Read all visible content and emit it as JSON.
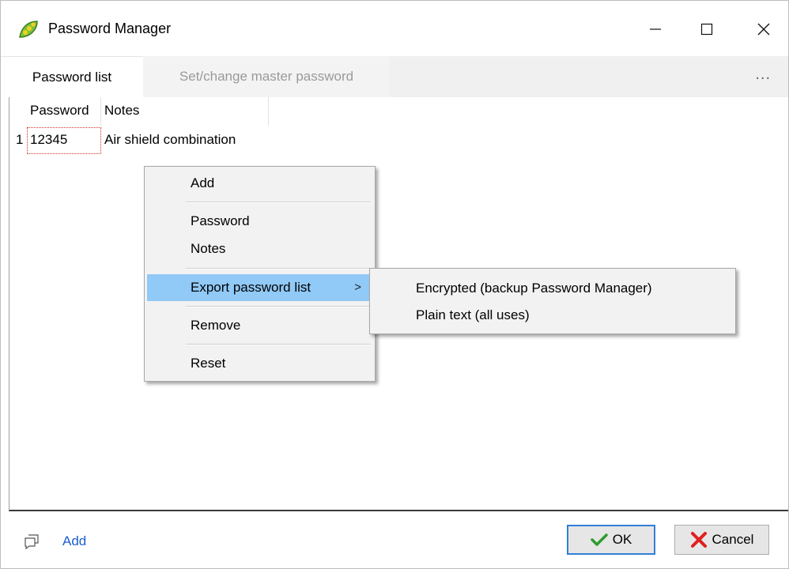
{
  "window": {
    "title": "Password Manager",
    "controls": {
      "minimize": "minimize-icon",
      "maximize": "maximize-icon",
      "close": "close-icon"
    }
  },
  "tabs": [
    {
      "label": "Password list",
      "active": true
    },
    {
      "label": "Set/change master password",
      "active": false
    }
  ],
  "tabs_more": "...",
  "grid": {
    "columns": [
      "Password",
      "Notes"
    ],
    "rows": [
      {
        "index": "1",
        "password": "12345",
        "notes": "Air shield combination"
      }
    ]
  },
  "context_menu": {
    "items": [
      {
        "label": "Add"
      },
      {
        "label": "Password"
      },
      {
        "label": "Notes"
      },
      {
        "label": "Export password list",
        "submenu": true,
        "highlighted": true
      },
      {
        "label": "Remove"
      },
      {
        "label": "Reset"
      }
    ],
    "submenu_arrow": ">"
  },
  "export_submenu": {
    "items": [
      {
        "label": "Encrypted (backup Password Manager)"
      },
      {
        "label": "Plain text (all uses)"
      }
    ]
  },
  "footer": {
    "add_label": "Add",
    "ok_label": "OK",
    "cancel_label": "Cancel"
  },
  "colors": {
    "highlight": "#91c9f7",
    "link": "#1a5fd0",
    "ok_border": "#2f7fd6",
    "ok_check": "#2e9c2e",
    "cancel_x": "#e02020"
  }
}
